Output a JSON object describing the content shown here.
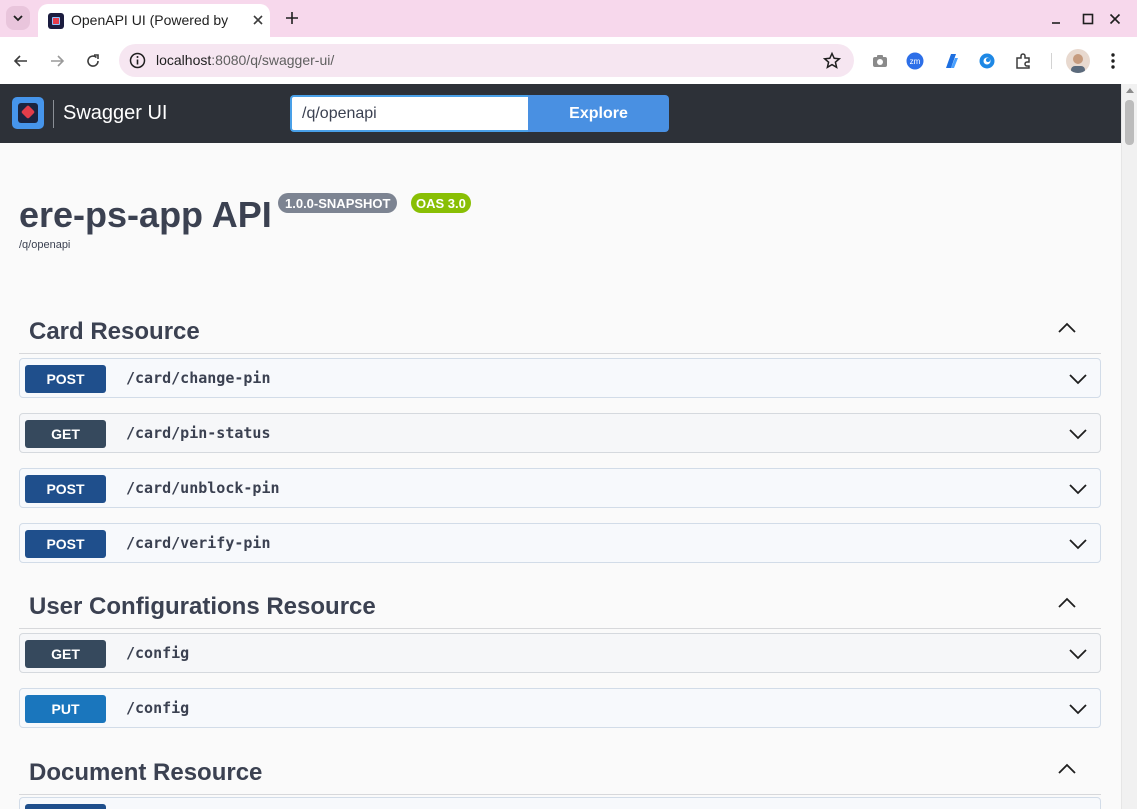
{
  "browser": {
    "tab_title": "OpenAPI UI (Powered by",
    "url_host": "localhost",
    "url_path": ":8080/q/swagger-ui/",
    "extension_icons": [
      "camera-icon",
      "zoom-extension-icon",
      "bookmark-extension-icon",
      "web-extension-icon",
      "extensions-icon"
    ]
  },
  "swagger": {
    "app_title": "Swagger UI",
    "url_input_value": "/q/openapi",
    "explore_label": "Explore"
  },
  "api": {
    "title": "ere-ps-app API",
    "version_badge": "1.0.0-SNAPSHOT",
    "oas_badge": "OAS 3.0",
    "spec_url": "/q/openapi"
  },
  "sections": [
    {
      "title": "Card Resource",
      "operations": [
        {
          "method": "POST",
          "path": "/card/change-pin"
        },
        {
          "method": "GET",
          "path": "/card/pin-status"
        },
        {
          "method": "POST",
          "path": "/card/unblock-pin"
        },
        {
          "method": "POST",
          "path": "/card/verify-pin"
        }
      ]
    },
    {
      "title": "User Configurations Resource",
      "operations": [
        {
          "method": "GET",
          "path": "/config"
        },
        {
          "method": "PUT",
          "path": "/config"
        }
      ]
    },
    {
      "title": "Document Resource",
      "operations": []
    }
  ],
  "colors": {
    "post": "#1f4f8c",
    "get": "#36495d",
    "put": "#1a76bd",
    "topbar": "#2d3138",
    "explore": "#4990e2",
    "oas_badge": "#89bf04",
    "version_badge": "#7d8492"
  }
}
